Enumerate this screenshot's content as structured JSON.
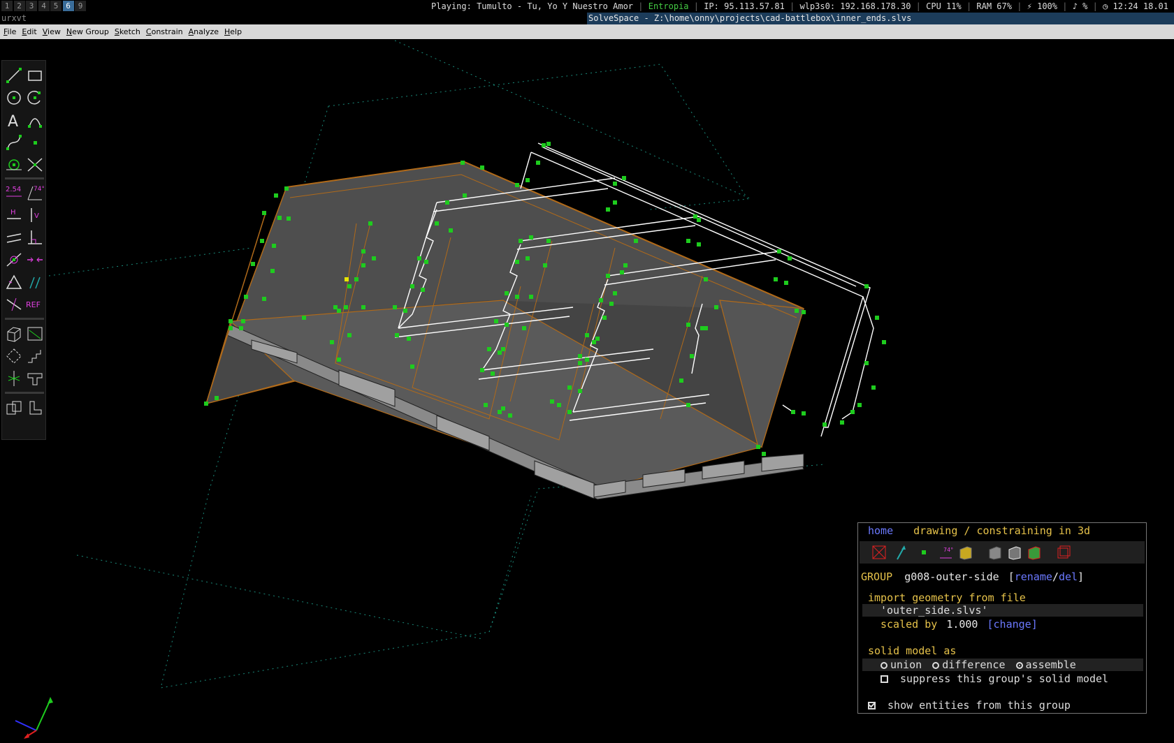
{
  "workspaces": [
    {
      "label": "1",
      "active": false
    },
    {
      "label": "2",
      "active": false
    },
    {
      "label": "3",
      "active": false
    },
    {
      "label": "4",
      "active": false
    },
    {
      "label": "5",
      "active": false
    },
    {
      "label": "6",
      "active": true
    },
    {
      "label": "9",
      "active": false
    }
  ],
  "status": {
    "playing": "Playing: Tumulto - Tu, Yo Y Nuestro Amor",
    "network": "Entropia",
    "ip": "IP: 95.113.57.81",
    "wlan": "wlp3s0: 192.168.178.30",
    "cpu": "CPU 11%",
    "ram": "RAM 67%",
    "battery": "⚡ 100%",
    "volume": "♪ %",
    "clock": "◷ 12:24 18.01"
  },
  "window": {
    "terminal_label": "urxvt",
    "title": "SolveSpace - Z:\\home\\onny\\projects\\cad-battlebox\\inner_ends.slvs"
  },
  "menu": {
    "items": [
      "File",
      "Edit",
      "View",
      "New Group",
      "Sketch",
      "Constrain",
      "Analyze",
      "Help"
    ]
  },
  "toolbar": {
    "distance_label": "2.54",
    "angle_label": "74°",
    "horizontal_label": "H",
    "vertical_label": "V",
    "ref_label": "REF",
    "text_label": "A",
    "tools": [
      "line-tool",
      "rectangle-tool",
      "circle-tool",
      "arc-tool",
      "text-tool",
      "tangent-arc-tool",
      "bezier-tool",
      "point-tool",
      "workplane-tool",
      "split-curves-tool",
      "distance-constraint",
      "angle-constraint",
      "horizontal-constraint",
      "vertical-constraint",
      "parallel-constraint",
      "perpendicular-constraint",
      "point-on-line-constraint",
      "symmetric-constraint",
      "equal-constraint",
      "same-orientation-constraint",
      "other-supplementary-tool",
      "reference-tool",
      "extrude-group",
      "workplane-group",
      "step-rotating-group",
      "step-translating-group",
      "revolve-group",
      "lathe-group",
      "assemble-group",
      "sketch-in-3d-group"
    ]
  },
  "browser": {
    "nav_home": "home",
    "nav_title": "drawing / constraining in 3d",
    "group_label": "GROUP",
    "group_name": "g008-outer-side",
    "bracket_open": "[",
    "rename": "rename",
    "slash": "/",
    "del": "del",
    "bracket_close": "]",
    "import_label": "import geometry from file",
    "file_name": "'outer_side.slvs'",
    "scaled_label": "scaled by",
    "scale_value": "1.000",
    "change": "[change]",
    "solid_label": "solid model as",
    "union": "union",
    "difference": "difference",
    "assemble": "assemble",
    "selected_mode": "assemble",
    "suppress_label": "suppress this group's solid model",
    "suppress_checked": false,
    "show_entities_label": "show entities from this group",
    "show_entities_checked": true
  },
  "colors": {
    "point": "#1ecc1e",
    "edge_orange": "#b06a1a",
    "face_gray": "#5a5a5a",
    "accent_yellow": "#e6c24a",
    "link_blue": "#6b79ff",
    "title_bar": "#1c3c5a"
  }
}
